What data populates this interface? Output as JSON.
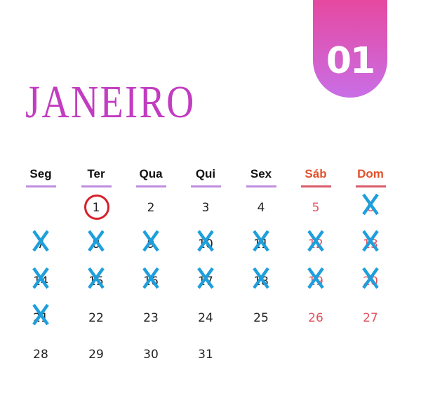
{
  "badge": {
    "number": "01"
  },
  "month": {
    "title": "JANEIRO"
  },
  "weekdays": [
    {
      "label": "Seg",
      "weekend": false
    },
    {
      "label": "Ter",
      "weekend": false
    },
    {
      "label": "Qua",
      "weekend": false
    },
    {
      "label": "Qui",
      "weekend": false
    },
    {
      "label": "Sex",
      "weekend": false
    },
    {
      "label": "Sáb",
      "weekend": true
    },
    {
      "label": "Dom",
      "weekend": true
    }
  ],
  "first_weekday_index": 1,
  "days_in_month": 31,
  "circled_days": [
    1
  ],
  "crossed_days": [
    6,
    7,
    8,
    9,
    10,
    11,
    12,
    13,
    14,
    15,
    16,
    17,
    18,
    19,
    20,
    21
  ],
  "colors": {
    "accent": "#c23cc0",
    "weekend": "#e2505f",
    "cross": "#1e9fdc",
    "circle": "#d8202a"
  }
}
